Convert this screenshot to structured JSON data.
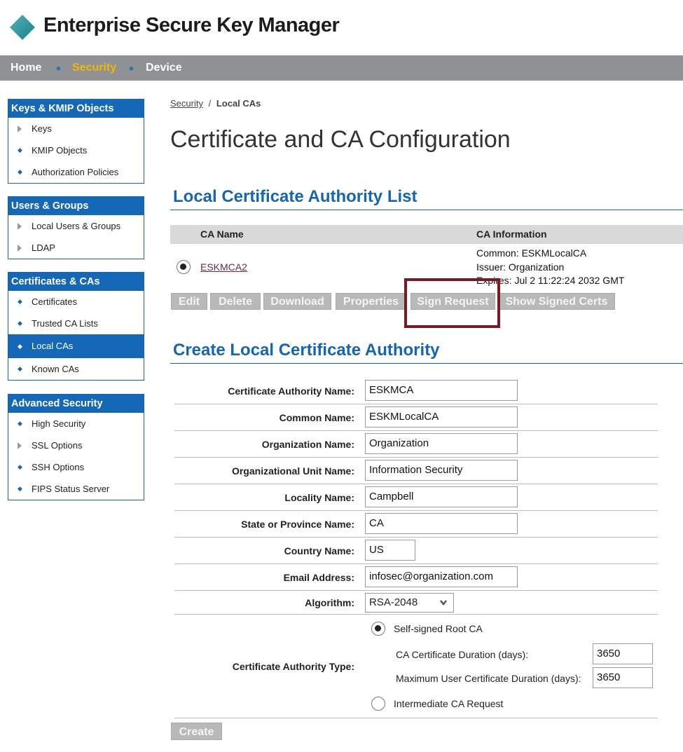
{
  "app": {
    "title": "Enterprise Secure Key Manager"
  },
  "nav": {
    "items": [
      {
        "label": "Home"
      },
      {
        "label": "Security"
      },
      {
        "label": "Device"
      }
    ]
  },
  "sidebar": {
    "groups": [
      {
        "title": "Keys & KMIP Objects",
        "items": [
          {
            "label": "Keys"
          },
          {
            "label": "KMIP Objects"
          },
          {
            "label": "Authorization Policies"
          }
        ]
      },
      {
        "title": "Users & Groups",
        "items": [
          {
            "label": "Local Users & Groups"
          },
          {
            "label": "LDAP"
          }
        ]
      },
      {
        "title": "Certificates & CAs",
        "items": [
          {
            "label": "Certificates"
          },
          {
            "label": "Trusted CA Lists"
          },
          {
            "label": "Local CAs"
          },
          {
            "label": "Known CAs"
          }
        ]
      },
      {
        "title": "Advanced Security",
        "items": [
          {
            "label": "High Security"
          },
          {
            "label": "SSL Options"
          },
          {
            "label": "SSH Options"
          },
          {
            "label": "FIPS Status Server"
          }
        ]
      }
    ]
  },
  "breadcrumb": {
    "parent": "Security",
    "separator": "/",
    "current": "Local CAs"
  },
  "page": {
    "title": "Certificate and CA Configuration"
  },
  "ca_list": {
    "title": "Local Certificate Authority List",
    "columns": {
      "name": "CA Name",
      "info": "CA Information"
    },
    "row": {
      "name": "ESKMCA2",
      "common": "Common: ESKMLocalCA",
      "issuer": "Issuer: Organization",
      "expires": "Expires: Jul  2 11:22:24 2032 GMT"
    },
    "buttons": {
      "edit": "Edit",
      "delete": "Delete",
      "download": "Download",
      "properties": "Properties",
      "sign_request": "Sign Request",
      "show_signed": "Show Signed Certs"
    }
  },
  "create_ca": {
    "title": "Create Local Certificate Authority",
    "fields": {
      "ca_name": {
        "label": "Certificate Authority Name:",
        "value": "ESKMCA"
      },
      "common_name": {
        "label": "Common Name:",
        "value": "ESKMLocalCA"
      },
      "org_name": {
        "label": "Organization Name:",
        "value": "Organization"
      },
      "org_unit": {
        "label": "Organizational Unit Name:",
        "value": "Information Security"
      },
      "locality": {
        "label": "Locality Name:",
        "value": "Campbell"
      },
      "state": {
        "label": "State or Province Name:",
        "value": "CA"
      },
      "country": {
        "label": "Country Name:",
        "value": "US"
      },
      "email": {
        "label": "Email Address:",
        "value": "infosec@organization.com"
      },
      "algorithm": {
        "label": "Algorithm:",
        "value": "RSA-2048"
      }
    },
    "ca_type": {
      "label": "Certificate Authority Type:",
      "self_signed": "Self-signed Root CA",
      "duration_label": "CA Certificate Duration (days):",
      "duration_value": "3650",
      "max_user_label": "Maximum User Certificate Duration (days):",
      "max_user_value": "3650",
      "intermediate": "Intermediate CA Request"
    },
    "create_button": "Create"
  },
  "colors": {
    "brand_blue": "#1565b0",
    "nav_gray": "#8f9194",
    "nav_active": "#f2b705",
    "highlight": "#7b1a24",
    "button_gray": "#b9b9b9"
  }
}
